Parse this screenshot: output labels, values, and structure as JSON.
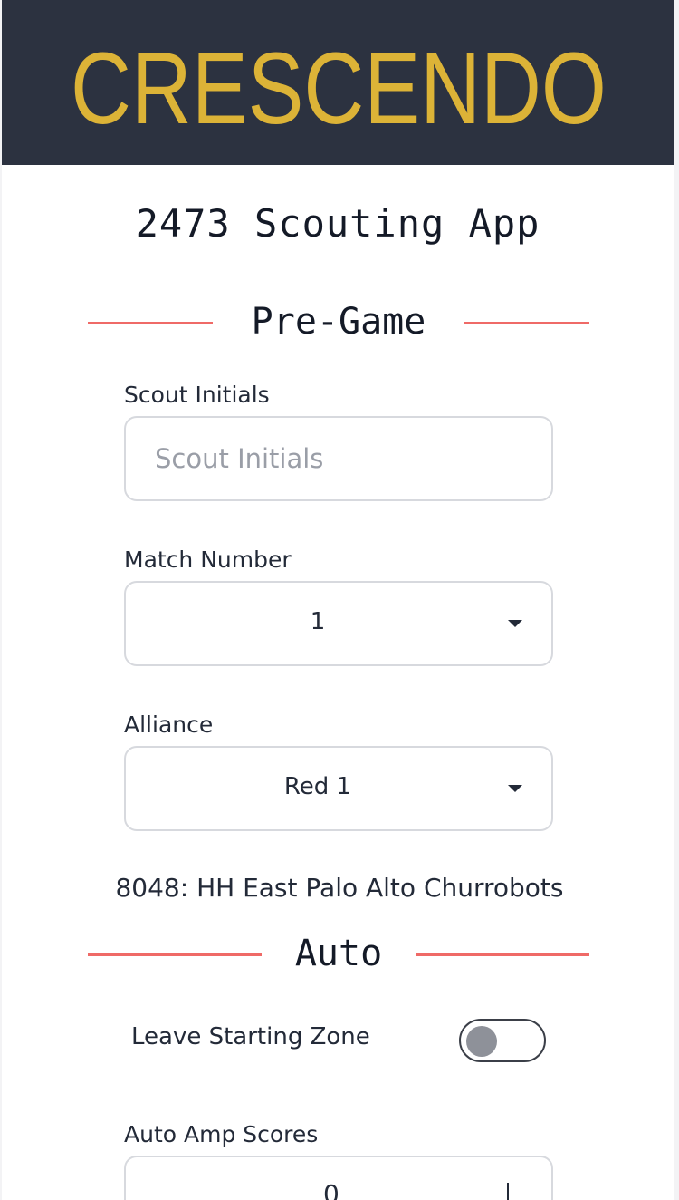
{
  "banner": {
    "logo_text": "CRESCENDO",
    "background": "#2c3240",
    "logo_color": "#dcb337"
  },
  "app_title": "2473 Scouting App",
  "accent_color": "#ef6a67",
  "pre_game": {
    "heading": "Pre-Game",
    "scout_initials": {
      "label": "Scout Initials",
      "placeholder": "Scout Initials",
      "value": ""
    },
    "match_number": {
      "label": "Match Number",
      "value": "1"
    },
    "alliance": {
      "label": "Alliance",
      "value": "Red 1"
    },
    "team_info": "8048: HH East Palo Alto Churrobots"
  },
  "auto": {
    "heading": "Auto",
    "leave_starting_zone": {
      "label": "Leave Starting Zone",
      "on": false
    },
    "amp_scores": {
      "label": "Auto Amp Scores",
      "value": "0"
    }
  }
}
